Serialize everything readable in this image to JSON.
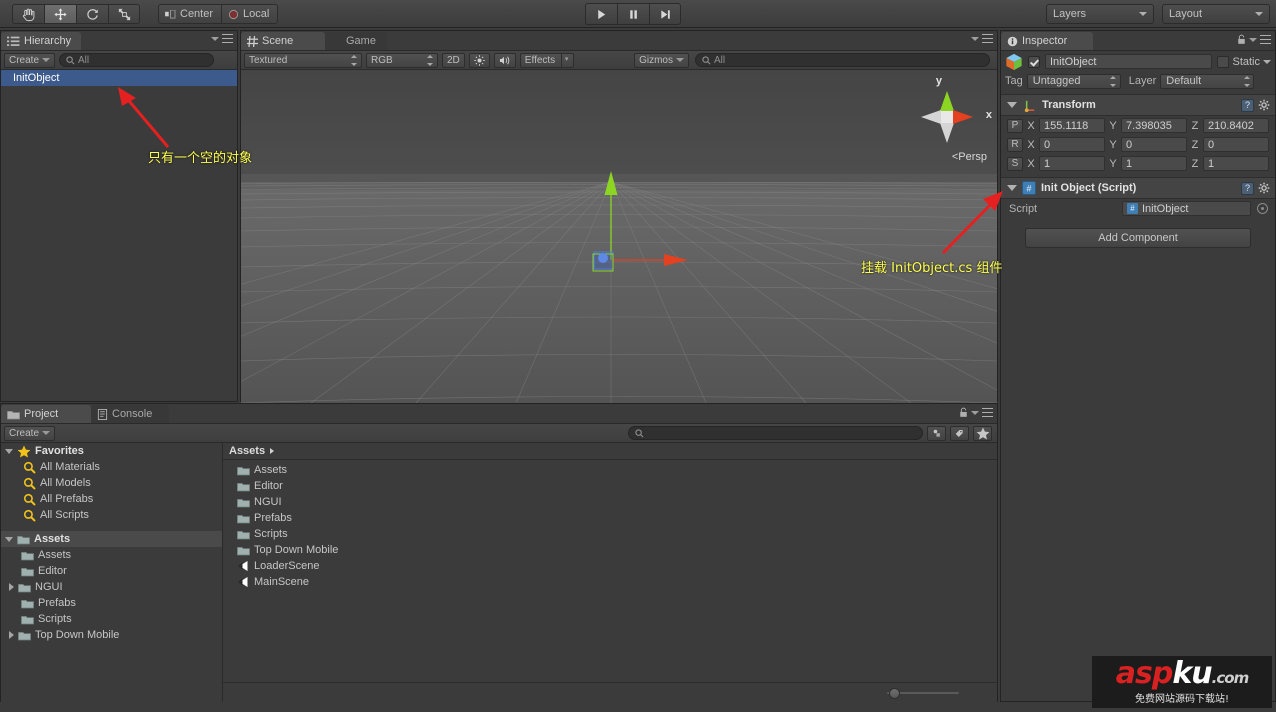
{
  "toolbar": {
    "tools": [
      {
        "name": "hand-tool",
        "label": "Hand"
      },
      {
        "name": "move-tool",
        "label": "Move"
      },
      {
        "name": "rotate-tool",
        "label": "Rotate"
      },
      {
        "name": "scale-tool",
        "label": "Scale"
      }
    ],
    "pivot_mode": "Center",
    "pivot_rotation": "Local",
    "play": "Play",
    "pause": "Pause",
    "step": "Step",
    "layers": "Layers",
    "layout": "Layout"
  },
  "hierarchy": {
    "tab": "Hierarchy",
    "create_label": "Create",
    "search_placeholder": "All",
    "items": [
      {
        "label": "InitObject",
        "selected": true
      }
    ]
  },
  "scene": {
    "tabs": [
      {
        "label": "Scene",
        "active": true
      },
      {
        "label": "Game",
        "active": false
      }
    ],
    "draw_mode": "Textured",
    "color_mode": "RGB",
    "toggle_2d": "2D",
    "lighting": "light-toggle",
    "audio": "audio-toggle",
    "effects": "Effects",
    "gizmos": "Gizmos",
    "search_placeholder": "All",
    "axis_x": "x",
    "axis_y": "y",
    "perspective": "Persp"
  },
  "inspector": {
    "tab": "Inspector",
    "object_name": "InitObject",
    "enabled": true,
    "static_label": "Static",
    "tag_label": "Tag",
    "tag_value": "Untagged",
    "layer_label": "Layer",
    "layer_value": "Default",
    "transform": {
      "title": "Transform",
      "rows": [
        {
          "badge": "P",
          "x": "155.1118",
          "y": "7.398035",
          "z": "210.8402"
        },
        {
          "badge": "R",
          "x": "0",
          "y": "0",
          "z": "0"
        },
        {
          "badge": "S",
          "x": "1",
          "y": "1",
          "z": "1"
        }
      ],
      "axis_labels": [
        "X",
        "Y",
        "Z"
      ]
    },
    "script_component": {
      "title": "Init Object (Script)",
      "script_label": "Script",
      "script_value": "InitObject"
    },
    "add_component": "Add Component"
  },
  "project": {
    "tabs": [
      {
        "label": "Project",
        "active": true
      },
      {
        "label": "Console",
        "active": false
      }
    ],
    "create_label": "Create",
    "search_placeholder": "",
    "favorites": {
      "label": "Favorites",
      "items": [
        "All Materials",
        "All Models",
        "All Prefabs",
        "All Scripts"
      ]
    },
    "assets_tree": {
      "label": "Assets",
      "items": [
        {
          "label": "Assets",
          "expandable": false
        },
        {
          "label": "Editor",
          "expandable": false
        },
        {
          "label": "NGUI",
          "expandable": true
        },
        {
          "label": "Prefabs",
          "expandable": false
        },
        {
          "label": "Scripts",
          "expandable": false
        },
        {
          "label": "Top Down Mobile",
          "expandable": true
        }
      ]
    },
    "breadcrumb": "Assets",
    "contents": [
      {
        "label": "Assets",
        "type": "folder"
      },
      {
        "label": "Editor",
        "type": "folder"
      },
      {
        "label": "NGUI",
        "type": "folder"
      },
      {
        "label": "Prefabs",
        "type": "folder"
      },
      {
        "label": "Scripts",
        "type": "folder"
      },
      {
        "label": "Top Down Mobile",
        "type": "folder"
      },
      {
        "label": "LoaderScene",
        "type": "scene"
      },
      {
        "label": "MainScene",
        "type": "scene"
      }
    ]
  },
  "annotations": [
    {
      "name": "hierarchy-annotation",
      "text": "只有一个空的对象"
    },
    {
      "name": "script-annotation",
      "text": "挂载 InitObject.cs 组件"
    }
  ],
  "watermark": {
    "part1": "asp",
    "part2": "ku",
    "domain": ".com",
    "tagline": "免费网站源码下载站!"
  },
  "colors": {
    "selection": "#3d5a8c",
    "annotation": "#ffff4d",
    "arrow": "#e52020",
    "axis_x": "#e3411f",
    "axis_y": "#8cd623",
    "panel_bg": "#3b3b3b"
  }
}
